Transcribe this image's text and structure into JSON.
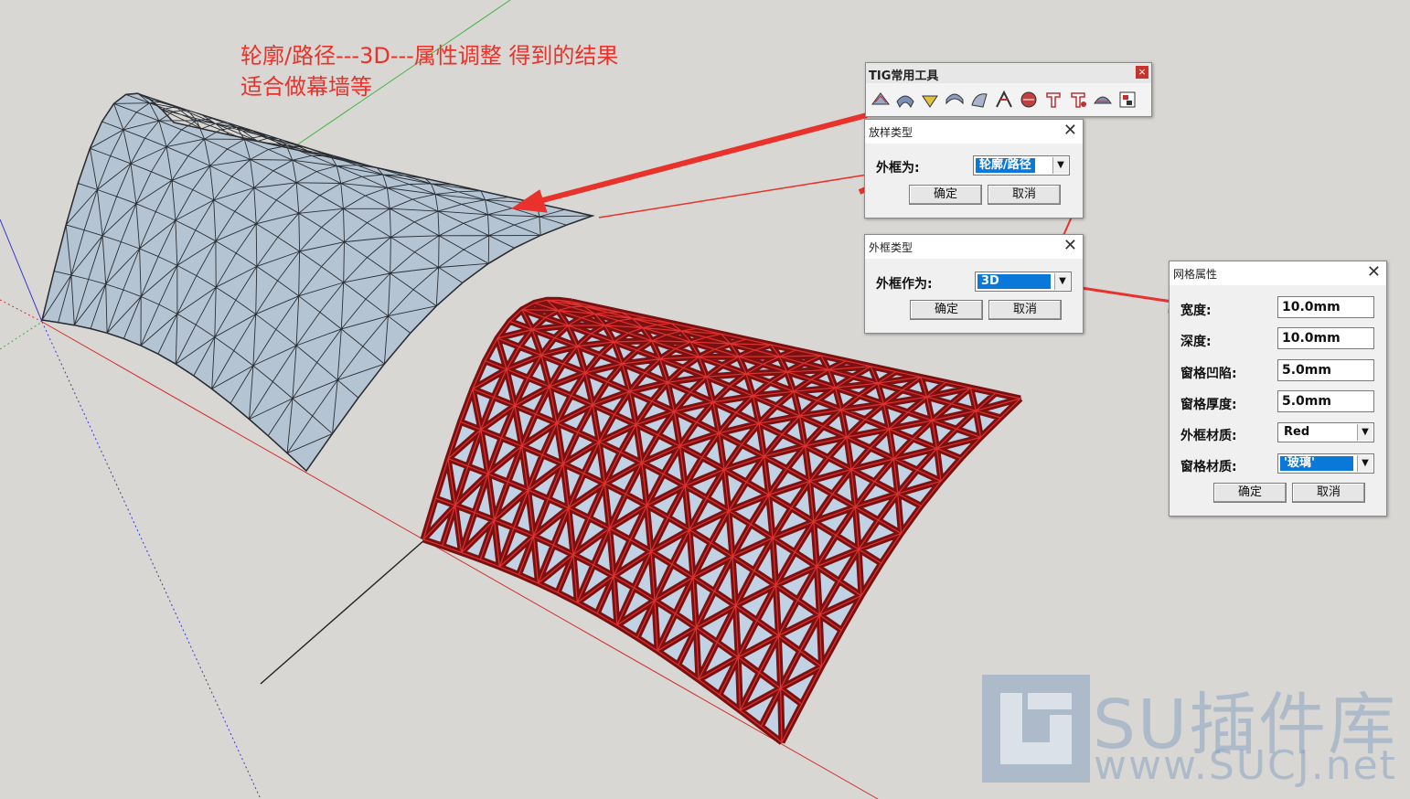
{
  "annotation": {
    "line1": "轮廓/路径---3D---属性调整 得到的结果",
    "line2": "适合做幕墙等"
  },
  "toolbar": {
    "title": "TIG常用工具",
    "close_glyph": "×",
    "tool_icons": [
      "loft-icon",
      "loft-icon",
      "loft-icon",
      "loft-icon",
      "loft-icon",
      "loft-icon",
      "loft-icon",
      "loft-icon",
      "loft-icon",
      "loft-icon",
      "settings-icon"
    ]
  },
  "loft_dialog": {
    "title": "放样类型",
    "label": "外框为:",
    "value": "轮廓/路径",
    "ok": "确定",
    "cancel": "取消"
  },
  "frame_dialog": {
    "title": "外框类型",
    "label": "外框作为:",
    "value": "3D",
    "ok": "确定",
    "cancel": "取消"
  },
  "grid_dialog": {
    "title": "网格属性",
    "fields": [
      {
        "label": "宽度:",
        "value": "10.0mm"
      },
      {
        "label": "深度:",
        "value": "10.0mm"
      },
      {
        "label": "窗格凹陷:",
        "value": "5.0mm"
      },
      {
        "label": "窗格厚度:",
        "value": "5.0mm"
      }
    ],
    "frame_material_label": "外框材质:",
    "frame_material_value": "Red",
    "pane_material_label": "窗格材质:",
    "pane_material_value": "'玻璃'",
    "ok": "确定",
    "cancel": "取消"
  },
  "watermark": {
    "title": "SU插件库",
    "url": "www.SUCJ.net"
  },
  "colors": {
    "annotation": "#e8322b",
    "arrow": "#e8322b",
    "surface_fill": "#b4c4d2",
    "frame_red": "#d8272a",
    "selection": "#0a78d8"
  }
}
